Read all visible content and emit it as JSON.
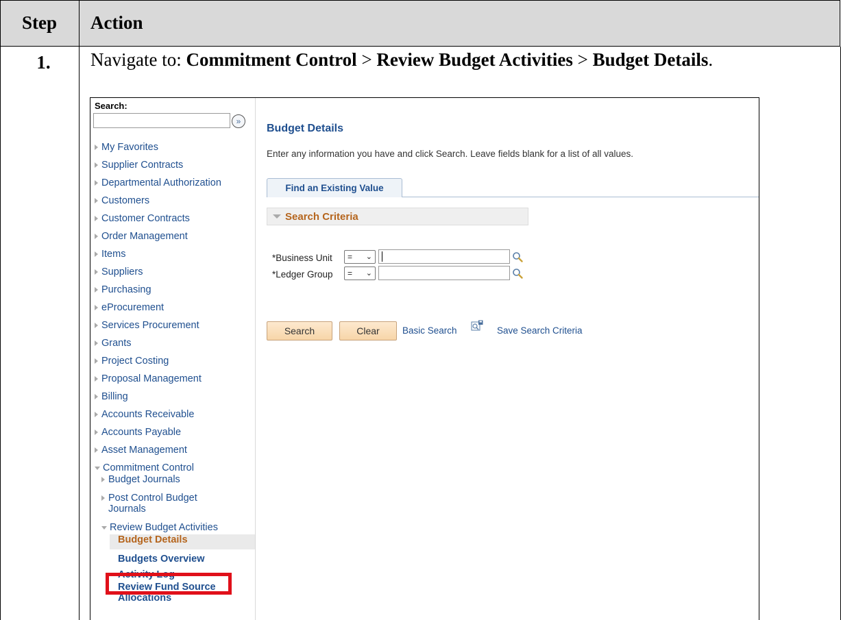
{
  "doc": {
    "header_step": "Step",
    "header_action": "Action",
    "step_number": "1.",
    "instruction_prefix": "Navigate to: ",
    "instruction_path": [
      {
        "text": "Commitment Control",
        "bold": true
      },
      {
        "text": " > ",
        "bold": false
      },
      {
        "text": "Review Budget Activities",
        "bold": true
      },
      {
        "text": " > ",
        "bold": false
      },
      {
        "text": "Budget Details",
        "bold": true
      },
      {
        "text": ".",
        "bold": false
      }
    ]
  },
  "sidebar": {
    "search_label": "Search:",
    "go_icon": "double-chevron-right-icon",
    "items": [
      "My Favorites",
      "Supplier Contracts",
      "Departmental Authorization",
      "Customers",
      "Customer Contracts",
      "Order Management",
      "Items",
      "Suppliers",
      "Purchasing",
      "eProcurement",
      "Services Procurement",
      "Grants",
      "Project Costing",
      "Proposal Management",
      "Billing",
      "Accounts Receivable",
      "Accounts Payable",
      "Asset Management"
    ],
    "expanded": "Commitment Control",
    "sub_items": [
      "Budget Journals",
      "Post Control Budget Journals"
    ],
    "sub_expanded": "Review Budget Activities",
    "leaves": [
      "Budget Details",
      "Budgets Overview",
      "Activity Log",
      "Review Fund Source Allocations"
    ],
    "active_leaf": "Budget Details",
    "highlight_color": "#e0101a"
  },
  "main": {
    "title": "Budget Details",
    "instructions": "Enter any information you have and click Search. Leave fields blank for a list of all values.",
    "tab": "Find an Existing Value",
    "section": "Search Criteria",
    "fields": [
      {
        "label": "*Business Unit",
        "operator": "=",
        "value": ""
      },
      {
        "label": "*Ledger Group",
        "operator": "=",
        "value": ""
      }
    ],
    "search_button": "Search",
    "clear_button": "Clear",
    "basic_search_link": "Basic Search",
    "save_search_link": "Save Search Criteria",
    "accent_color": "#b5651d",
    "link_color": "#1f4f8f"
  }
}
